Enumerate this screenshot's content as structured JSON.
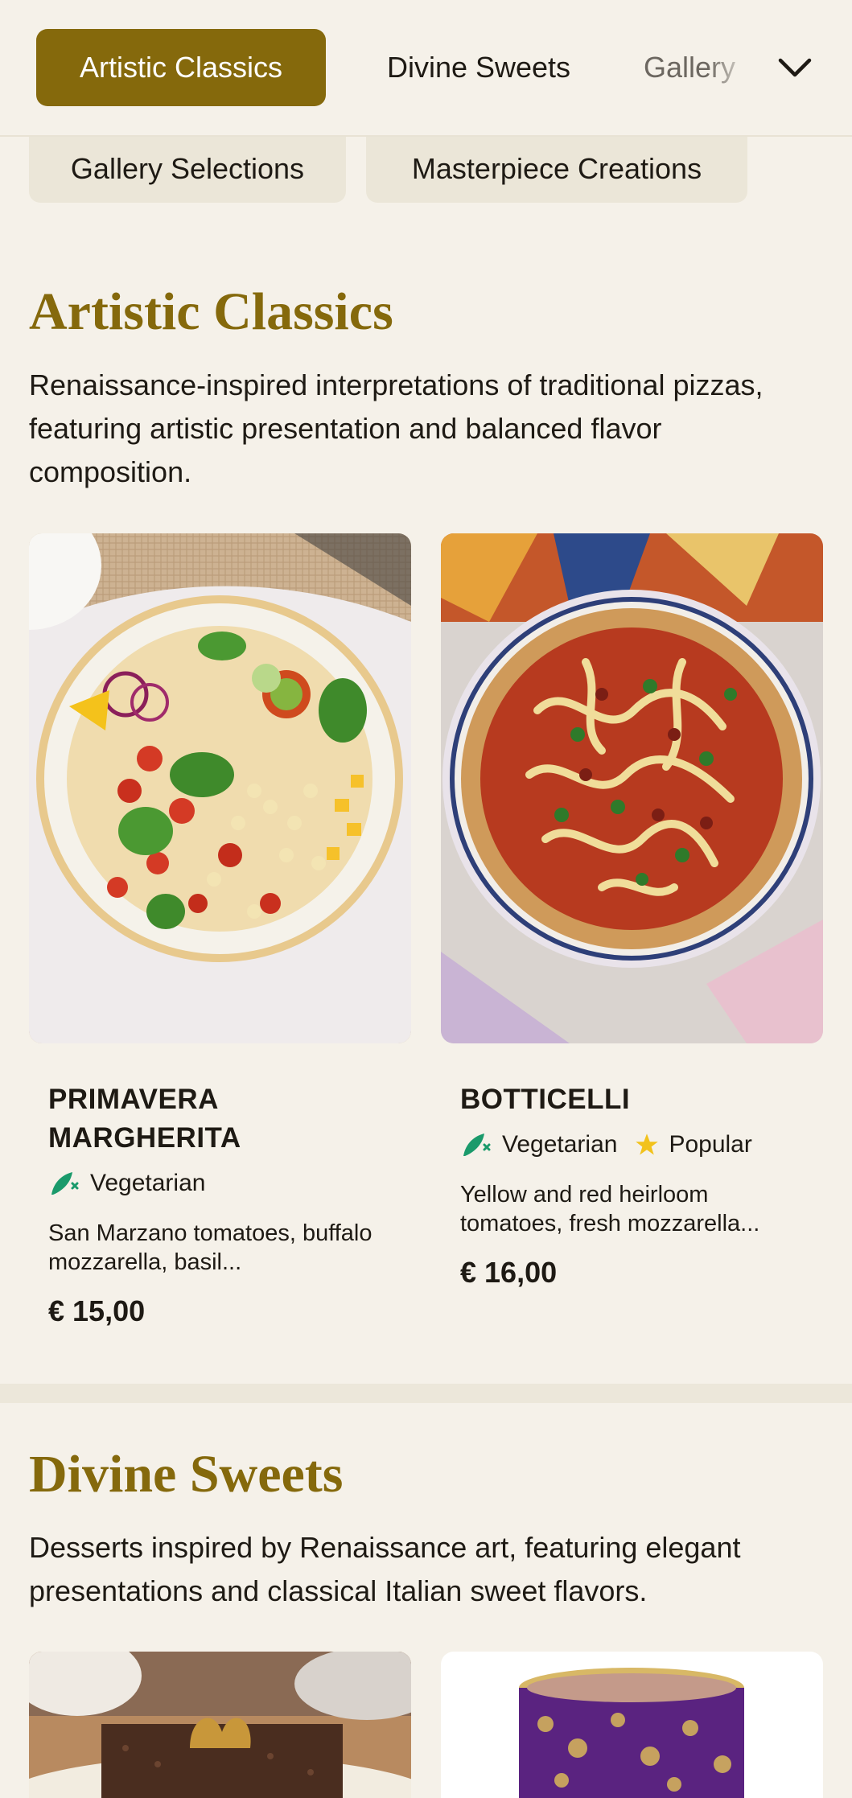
{
  "nav": {
    "tabs": [
      {
        "label": "Artistic Classics",
        "active": true
      },
      {
        "label": "Divine Sweets",
        "active": false
      },
      {
        "label": "Gallery",
        "active": false
      }
    ],
    "expand_icon": "chevron-down-icon"
  },
  "chips": [
    "Gallery Selections",
    "Masterpiece Creations"
  ],
  "sections": [
    {
      "title": "Artistic Classics",
      "description": "Renaissance-inspired interpretations of traditional pizzas, featuring artistic presentation and balanced flavor composition.",
      "items": [
        {
          "name": "PRIMAVERA MARGHERITA",
          "tags": [
            {
              "label": "Vegetarian",
              "icon": "vegetarian-icon"
            }
          ],
          "description": "San Marzano tomatoes, buffalo mozzarella, basil...",
          "price": "€ 15,00"
        },
        {
          "name": "BOTTICELLI",
          "tags": [
            {
              "label": "Vegetarian",
              "icon": "vegetarian-icon"
            },
            {
              "label": "Popular",
              "icon": "star-icon"
            }
          ],
          "description": "Yellow and red heirloom tomatoes, fresh mozzarella...",
          "price": "€ 16,00"
        }
      ]
    },
    {
      "title": "Divine Sweets",
      "description": "Desserts inspired by Renaissance art, featuring elegant presentations and classical Italian sweet flavors."
    }
  ],
  "colors": {
    "accent": "#85690c",
    "background": "#f5f1e9",
    "veg": "#1a9a6b",
    "star": "#f2c21b"
  }
}
